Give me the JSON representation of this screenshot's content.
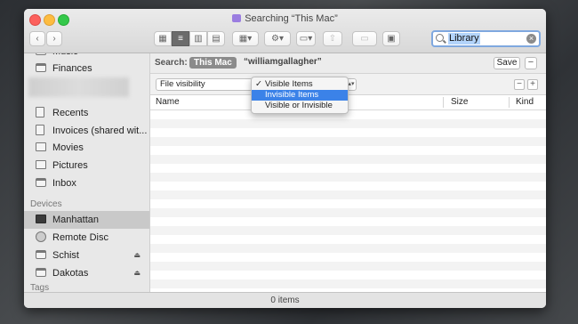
{
  "window": {
    "title": "Searching “This Mac”",
    "search_value": "Library",
    "status": "0 items"
  },
  "sidebar": {
    "items": [
      {
        "label": "Music",
        "icon": "folder-icon"
      },
      {
        "label": "Finances",
        "icon": "folder-icon"
      },
      {
        "label": "Recents",
        "icon": "recents-icon"
      },
      {
        "label": "Invoices (shared wit...",
        "icon": "doc-icon"
      },
      {
        "label": "Movies",
        "icon": "movies-icon"
      },
      {
        "label": "Pictures",
        "icon": "pictures-icon"
      },
      {
        "label": "Inbox",
        "icon": "folder-icon"
      }
    ],
    "devices_header": "Devices",
    "devices": [
      {
        "label": "Manhattan",
        "icon": "monitor-icon",
        "selected": true
      },
      {
        "label": "Remote Disc",
        "icon": "disc-icon"
      },
      {
        "label": "Schist",
        "icon": "drive-icon",
        "eject": true
      },
      {
        "label": "Dakotas",
        "icon": "drive-icon",
        "eject": true
      }
    ],
    "tags_header": "Tags"
  },
  "searchbar": {
    "label": "Search:",
    "scope_this_mac": "This Mac",
    "scope_user": "“williamgallagher”",
    "save_label": "Save",
    "minus_label": "−"
  },
  "criteria": {
    "attribute": "File visibility",
    "minus_label": "−",
    "plus_label": "+"
  },
  "dropdown": {
    "options": [
      "Visible Items",
      "Invisible Items",
      "Visible or Invisible"
    ],
    "checked": "Visible Items",
    "highlighted": "Invisible Items"
  },
  "columns": {
    "name": "Name",
    "size": "Size",
    "kind": "Kind"
  },
  "colors": {
    "highlight": "#3b82e8",
    "search_selection": "#b3d4fb"
  }
}
